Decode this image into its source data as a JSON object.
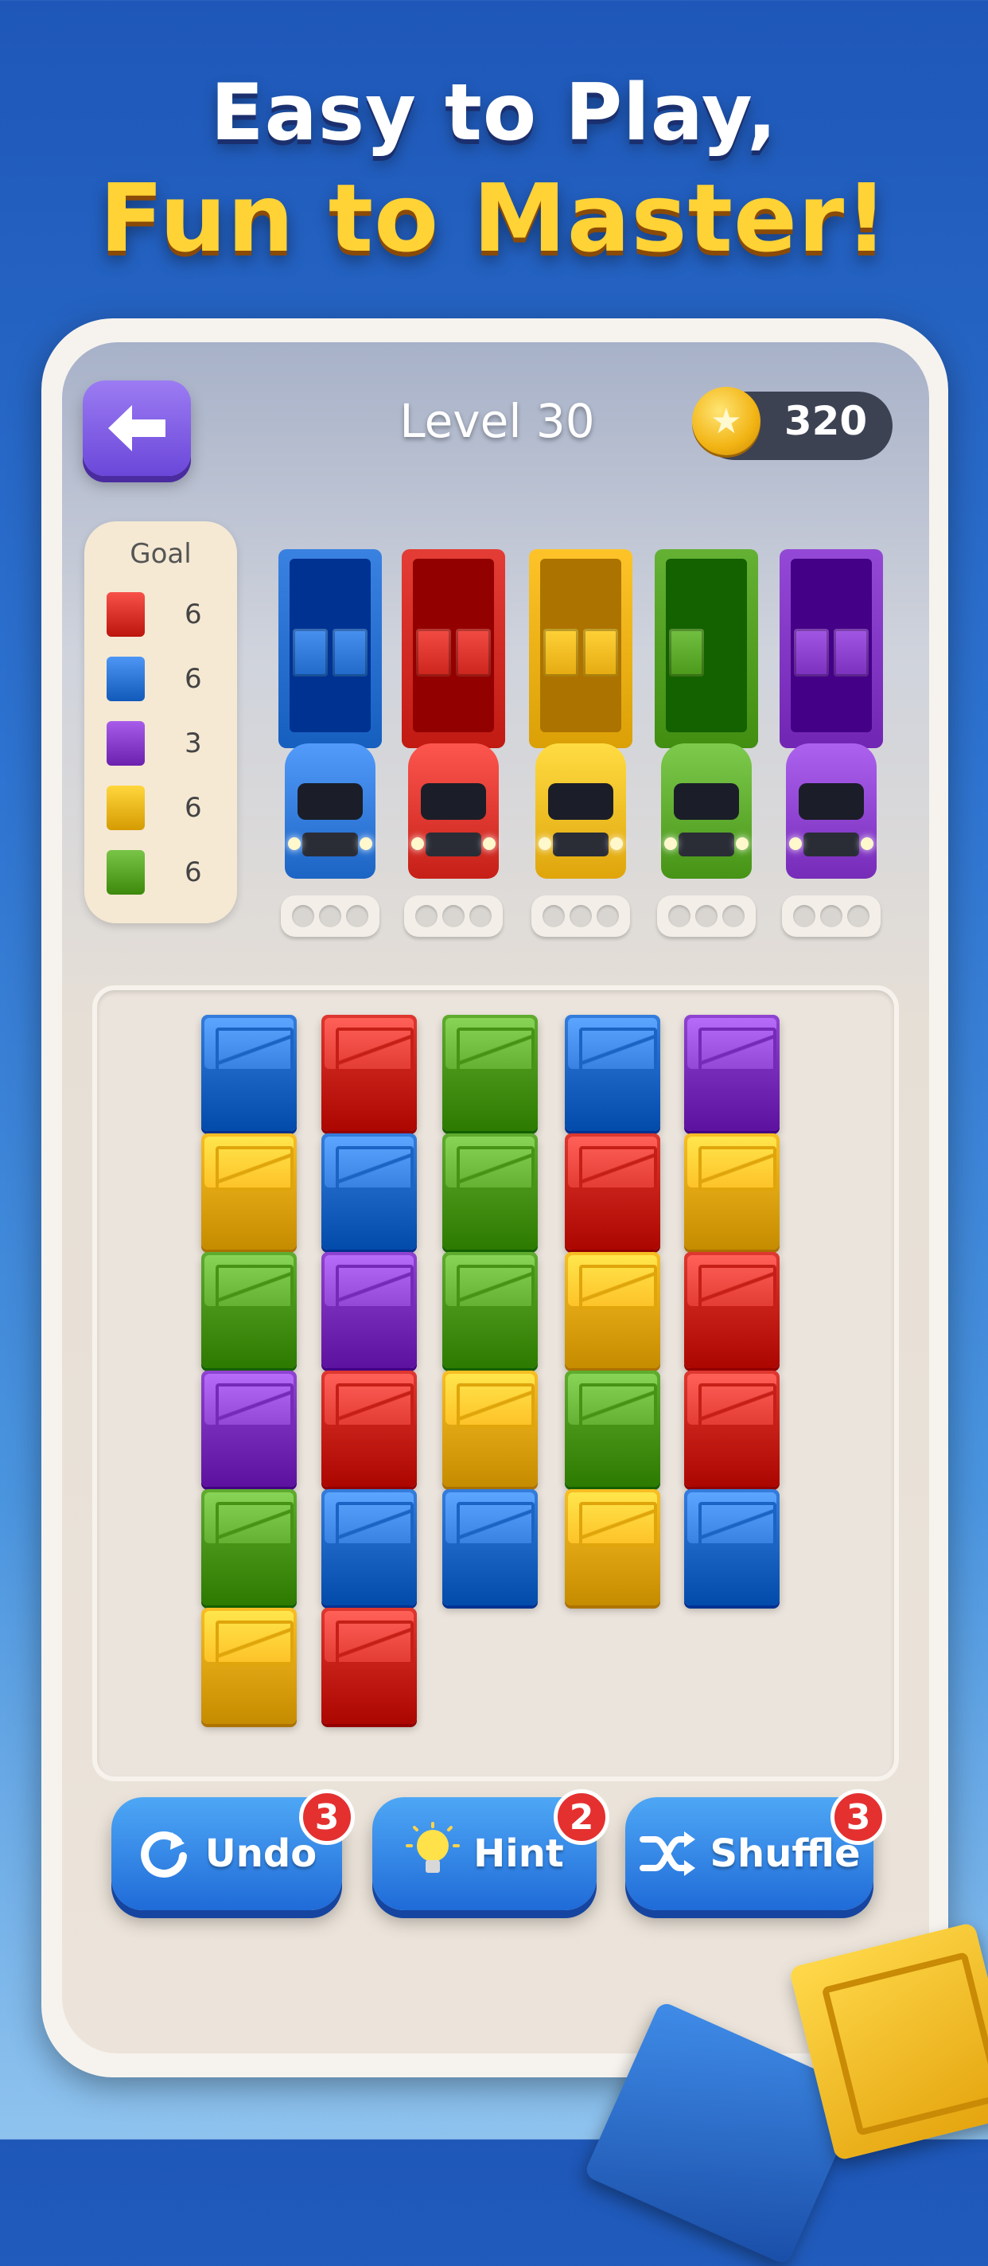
{
  "headline": {
    "line1": "Easy to Play,",
    "line2": "Fun to Master!"
  },
  "hud": {
    "level": "Level 30",
    "coins": "320"
  },
  "colors": {
    "red": "#d9332b",
    "blue": "#2f78d8",
    "purple": "#8a3fcc",
    "yellow": "#f3b91f",
    "green": "#5aa72a"
  },
  "goal": {
    "title": "Goal",
    "items": [
      {
        "color": "red",
        "count": "6"
      },
      {
        "color": "blue",
        "count": "6"
      },
      {
        "color": "purple",
        "count": "3"
      },
      {
        "color": "yellow",
        "count": "6"
      },
      {
        "color": "green",
        "count": "6"
      }
    ]
  },
  "trucks": [
    {
      "color": "blue",
      "cargo": 2
    },
    {
      "color": "red",
      "cargo": 2
    },
    {
      "color": "yellow",
      "cargo": 2
    },
    {
      "color": "green",
      "cargo": 1
    },
    {
      "color": "purple",
      "cargo": 2
    }
  ],
  "board": {
    "columns": [
      [
        "blue",
        "yellow",
        "green",
        "purple",
        "green",
        "yellow"
      ],
      [
        "red",
        "blue",
        "purple",
        "red",
        "blue",
        "red"
      ],
      [
        "green",
        "green",
        "green",
        "yellow",
        "blue"
      ],
      [
        "blue",
        "red",
        "yellow",
        "green",
        "yellow"
      ],
      [
        "purple",
        "yellow",
        "red",
        "red",
        "blue"
      ]
    ]
  },
  "buttons": {
    "undo": {
      "label": "Undo",
      "count": "3"
    },
    "hint": {
      "label": "Hint",
      "count": "2"
    },
    "shuffle": {
      "label": "Shuffle",
      "count": "3"
    }
  }
}
